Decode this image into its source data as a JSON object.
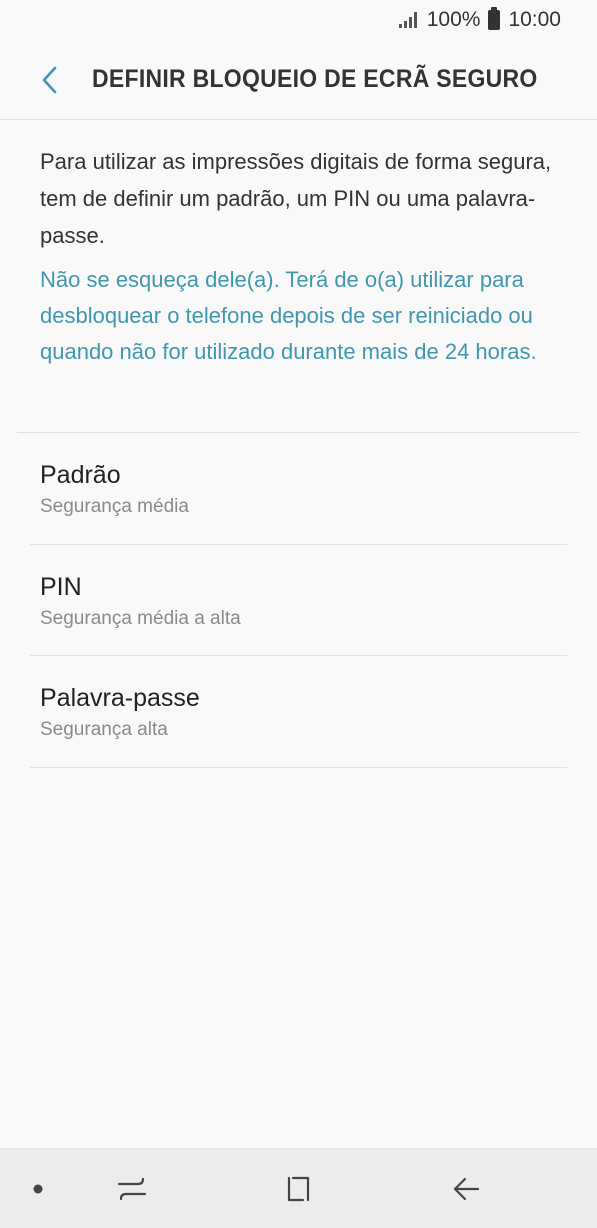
{
  "status_bar": {
    "battery_text": "100%",
    "time": "10:00"
  },
  "header": {
    "title": "DEFINIR BLOQUEIO DE ECRÃ SEGURO"
  },
  "main": {
    "description": "Para utilizar as impressões digitais de forma segura, tem de definir um padrão, um PIN ou uma palavra-passe.",
    "warning": "Não se esqueça dele(a). Terá de o(a) utilizar para desbloquear o telefone depois de ser reiniciado ou quando não for utilizado durante mais de 24 horas.",
    "options": [
      {
        "title": "Padrão",
        "subtitle": "Segurança média"
      },
      {
        "title": "PIN",
        "subtitle": "Segurança média a alta"
      },
      {
        "title": "Palavra-passe",
        "subtitle": "Segurança alta"
      }
    ]
  },
  "colors": {
    "accent": "#3f97b0",
    "background": "#f9f9f9",
    "nav_bar": "#ececec"
  },
  "icons": {
    "back": "chevron-left-icon",
    "signal": "signal-icon",
    "battery": "battery-icon",
    "nav_dot": "dot-icon",
    "nav_recents": "recents-icon",
    "nav_home": "home-icon",
    "nav_back": "back-arrow-icon"
  }
}
